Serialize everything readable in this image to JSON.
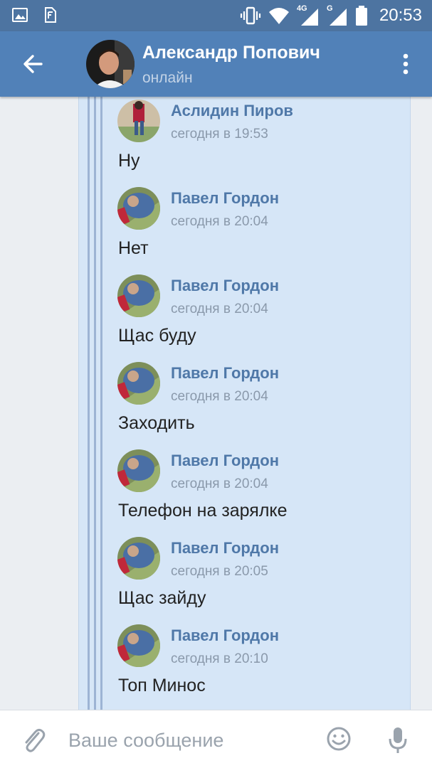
{
  "status_bar": {
    "time": "20:53",
    "icons": [
      "gallery-icon",
      "sim-card-icon",
      "vibrate-icon",
      "wifi-icon",
      "signal-4g-icon",
      "signal-g-icon",
      "battery-icon"
    ],
    "network_labels": [
      "4G",
      "G"
    ]
  },
  "header": {
    "contact_name": "Александр Попович",
    "status": "онлайн"
  },
  "messages": [
    {
      "author": "Аслидин Пиров",
      "time": "сегодня в 19:53",
      "text": "Ну"
    },
    {
      "author": "Павел Гордон",
      "time": "сегодня в 20:04",
      "text": "Нет"
    },
    {
      "author": "Павел Гордон",
      "time": "сегодня в 20:04",
      "text": "Щас буду"
    },
    {
      "author": "Павел Гордон",
      "time": "сегодня в 20:04",
      "text": "Заходить"
    },
    {
      "author": "Павел Гордон",
      "time": "сегодня в 20:04",
      "text": "Телефон на зарялке"
    },
    {
      "author": "Павел Гордон",
      "time": "сегодня в 20:05",
      "text": "Щас зайду"
    },
    {
      "author": "Павел Гордон",
      "time": "сегодня в 20:10",
      "text": "Топ Минос"
    }
  ],
  "input": {
    "placeholder": "Ваше сообщение",
    "value": ""
  },
  "colors": {
    "status_bar": "#4d74a1",
    "header": "#5181b8",
    "bubble": "#d6e6f7",
    "author": "#4f78a8",
    "time": "#8a99ab"
  }
}
